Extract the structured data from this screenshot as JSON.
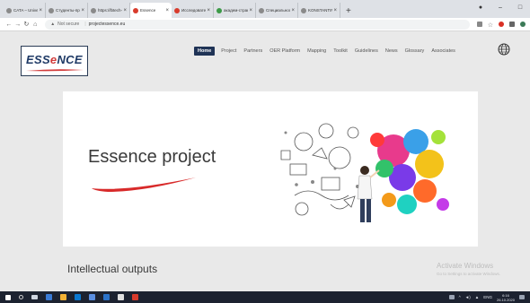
{
  "browser": {
    "tabs": [
      {
        "label": "CATA – Universi",
        "active": false
      },
      {
        "label": "Студенты-прог",
        "active": false
      },
      {
        "label": "https://lbtech-n",
        "active": false
      },
      {
        "label": "Essence",
        "active": true
      },
      {
        "label": "Исследовательс",
        "active": false
      },
      {
        "label": "академ-страни",
        "active": false
      },
      {
        "label": "Специальность",
        "active": false
      },
      {
        "label": "KONSTANTIN",
        "active": false
      }
    ],
    "new_tab": "+",
    "address": {
      "security": "Not secure",
      "url": "projectessence.eu"
    }
  },
  "site": {
    "logo_text_a": "ESS",
    "logo_text_b": "e",
    "logo_text_c": "NCE",
    "nav": [
      {
        "label": "Home",
        "active": true
      },
      {
        "label": "Project"
      },
      {
        "label": "Partners"
      },
      {
        "label": "OER Platform"
      },
      {
        "label": "Mapping"
      },
      {
        "label": "Toolkit"
      },
      {
        "label": "Guidelines"
      },
      {
        "label": "News"
      },
      {
        "label": "Glossary"
      },
      {
        "label": "Associates"
      }
    ],
    "hero_title": "Essence project",
    "section_title": "Intellectual outputs"
  },
  "watermark": {
    "line1": "Activate Windows",
    "line2": "Go to Settings to activate Windows."
  },
  "taskbar": {
    "lang": "ENG",
    "time": "6:16",
    "date": "26.10.2020"
  },
  "colors": {
    "nav_active": "#1f3356",
    "accent_red": "#d23b3b",
    "logo_blue": "#1f3a66"
  }
}
